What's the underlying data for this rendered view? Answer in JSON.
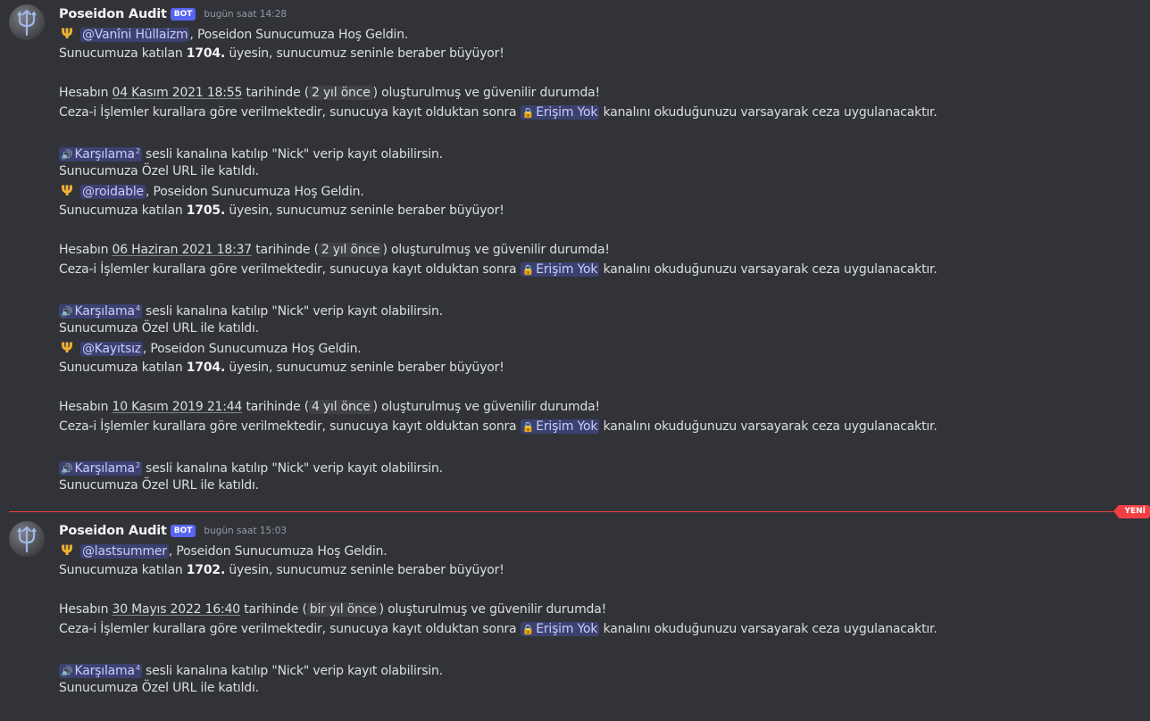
{
  "colors": {
    "background": "#313338",
    "mention": "#c9cdfb",
    "bot_tag": "#5865f2",
    "new_divider": "#f23f43",
    "icon_gold": "#f0b232"
  },
  "new_label": "YENİ",
  "groups": [
    {
      "username": "Poseidon Audit",
      "bot_tag": "BOT",
      "timestamp": "bugün saat 14:28",
      "messages": [
        {
          "icon": "Ψ",
          "mention": "@Vanîni Hüllaizm",
          "welcome": ", Poseidon Sunucumuza Hoş Geldin.",
          "count_prefix": "Sunucumuza katılan ",
          "count": "1704.",
          "count_suffix": " üyesin, sunucumuz seninle beraber büyüyor!",
          "acc_prefix": "Hesabın ",
          "acc_date": "04 Kasım 2021 18:55",
          "acc_mid": " tarihinde (",
          "acc_rel": "2 yıl önce",
          "acc_suffix": ") oluşturulmuş ve güvenilir durumda!",
          "rules_prefix": "Ceza-i İşlemler kurallara göre verilmektedir, sunucuya kayıt olduktan sonra ",
          "rules_channel": "Erişim Yok",
          "rules_suffix": " kanalını okuduğunuzu varsayarak ceza uygulanacaktır.",
          "voice_channel": "Karşılama",
          "voice_count": "2",
          "voice_suffix": " sesli kanalına katılıp \"Nick\" verip kayıt olabilirsin.",
          "invite": "Sunucumuza Özel URL ile katıldı."
        },
        {
          "icon": "Ψ",
          "mention": "@roidable",
          "welcome": ", Poseidon Sunucumuza Hoş Geldin.",
          "count_prefix": "Sunucumuza katılan ",
          "count": "1705.",
          "count_suffix": " üyesin, sunucumuz seninle beraber büyüyor!",
          "acc_prefix": "Hesabın ",
          "acc_date": "06 Haziran 2021 18:37",
          "acc_mid": " tarihinde (",
          "acc_rel": "2 yıl önce",
          "acc_suffix": ") oluşturulmuş ve güvenilir durumda!",
          "rules_prefix": "Ceza-i İşlemler kurallara göre verilmektedir, sunucuya kayıt olduktan sonra ",
          "rules_channel": "Erişim Yok",
          "rules_suffix": " kanalını okuduğunuzu varsayarak ceza uygulanacaktır.",
          "voice_channel": "Karşılama",
          "voice_count": "4",
          "voice_suffix": " sesli kanalına katılıp \"Nick\" verip kayıt olabilirsin.",
          "invite": "Sunucumuza Özel URL ile katıldı."
        },
        {
          "icon": "Ψ",
          "mention": "@Kayıtsız",
          "welcome": ", Poseidon Sunucumuza Hoş Geldin.",
          "count_prefix": "Sunucumuza katılan ",
          "count": "1704.",
          "count_suffix": " üyesin, sunucumuz seninle beraber büyüyor!",
          "acc_prefix": "Hesabın ",
          "acc_date": "10 Kasım 2019 21:44",
          "acc_mid": " tarihinde (",
          "acc_rel": "4 yıl önce",
          "acc_suffix": ") oluşturulmuş ve güvenilir durumda!",
          "rules_prefix": "Ceza-i İşlemler kurallara göre verilmektedir, sunucuya kayıt olduktan sonra ",
          "rules_channel": "Erişim Yok",
          "rules_suffix": " kanalını okuduğunuzu varsayarak ceza uygulanacaktır.",
          "voice_channel": "Karşılama",
          "voice_count": "2",
          "voice_suffix": " sesli kanalına katılıp \"Nick\" verip kayıt olabilirsin.",
          "invite": "Sunucumuza Özel URL ile katıldı."
        }
      ]
    },
    {
      "username": "Poseidon Audit",
      "bot_tag": "BOT",
      "timestamp": "bugün saat 15:03",
      "messages": [
        {
          "icon": "Ψ",
          "mention": "@lastsummer",
          "welcome": ", Poseidon Sunucumuza Hoş Geldin.",
          "count_prefix": "Sunucumuza katılan ",
          "count": "1702.",
          "count_suffix": " üyesin, sunucumuz seninle beraber büyüyor!",
          "acc_prefix": "Hesabın ",
          "acc_date": "30 Mayıs 2022 16:40",
          "acc_mid": " tarihinde (",
          "acc_rel": "bir yıl önce",
          "acc_suffix": ") oluşturulmuş ve güvenilir durumda!",
          "rules_prefix": "Ceza-i İşlemler kurallara göre verilmektedir, sunucuya kayıt olduktan sonra ",
          "rules_channel": "Erişim Yok",
          "rules_suffix": " kanalını okuduğunuzu varsayarak ceza uygulanacaktır.",
          "voice_channel": "Karşılama",
          "voice_count": "4",
          "voice_suffix": " sesli kanalına katılıp \"Nick\" verip kayıt olabilirsin.",
          "invite": "Sunucumuza Özel URL ile katıldı."
        }
      ]
    }
  ]
}
